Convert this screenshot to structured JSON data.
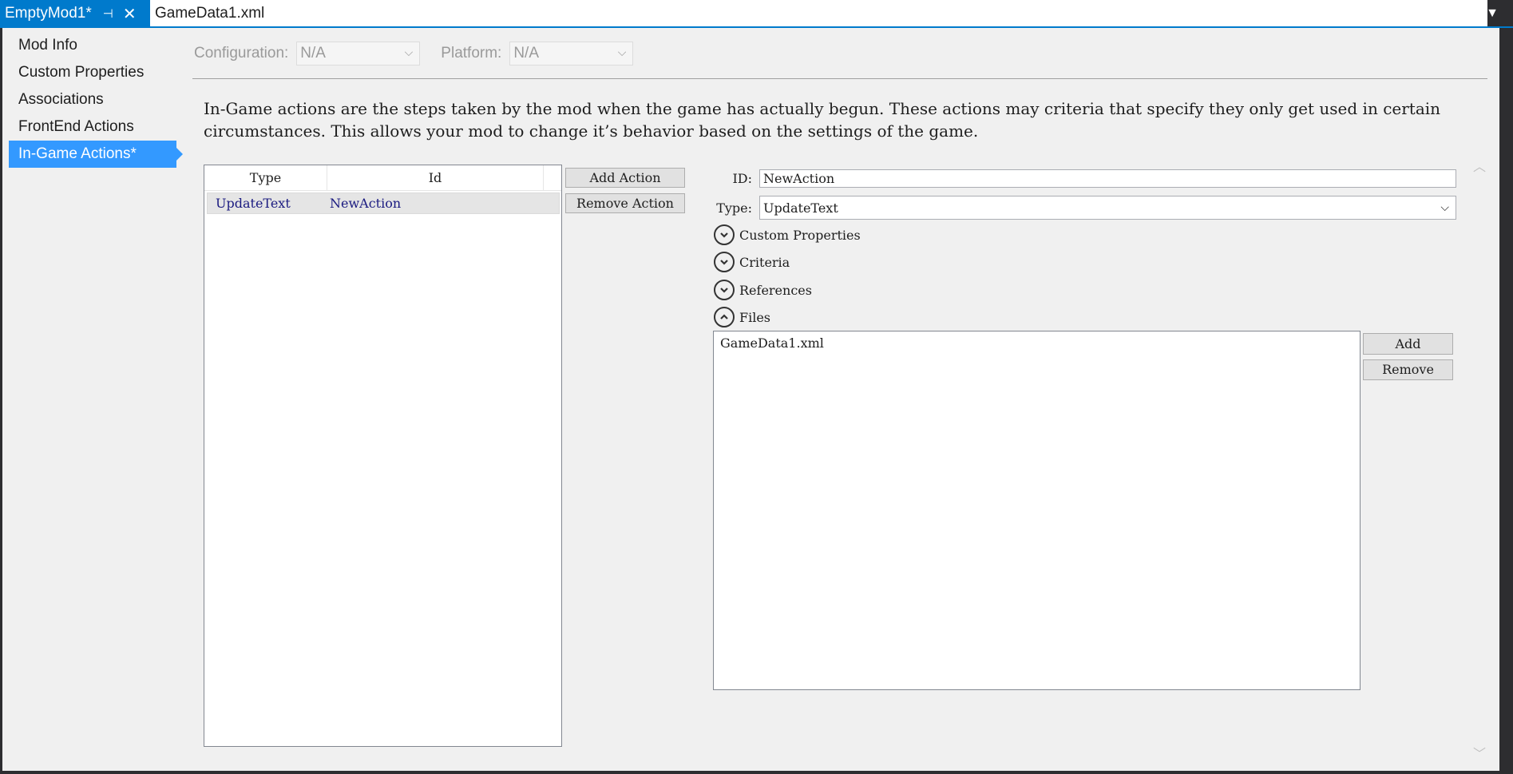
{
  "tabs": [
    {
      "label": "EmptyMod1*",
      "active": true
    },
    {
      "label": "GameData1.xml",
      "active": false
    }
  ],
  "icons": {
    "pin": "pin-icon",
    "close": "close-icon",
    "dropdown": "chevron-down-icon"
  },
  "nav": {
    "items": [
      {
        "label": "Mod Info"
      },
      {
        "label": "Custom Properties"
      },
      {
        "label": "Associations"
      },
      {
        "label": "FrontEnd Actions"
      },
      {
        "label": "In-Game Actions*"
      }
    ],
    "selected_index": 4
  },
  "config": {
    "configuration_label": "Configuration:",
    "configuration_value": "N/A",
    "platform_label": "Platform:",
    "platform_value": "N/A"
  },
  "description": "In-Game actions are the steps taken by the mod when the game has actually begun.  These actions may criteria that specify they only get used in certain circumstances.  This allows your mod to change it’s behavior based on the settings of the game.",
  "actions_list": {
    "columns": [
      "Type",
      "Id"
    ],
    "rows": [
      {
        "type": "UpdateText",
        "id": "NewAction"
      }
    ]
  },
  "buttons": {
    "add_action": "Add Action",
    "remove_action": "Remove Action",
    "add": "Add",
    "remove": "Remove"
  },
  "detail": {
    "id_label": "ID:",
    "id_value": "NewAction",
    "type_label": "Type:",
    "type_value": "UpdateText"
  },
  "expanders": [
    {
      "label": "Custom Properties",
      "expanded": false
    },
    {
      "label": "Criteria",
      "expanded": false
    },
    {
      "label": "References",
      "expanded": false
    },
    {
      "label": "Files",
      "expanded": true
    }
  ],
  "files": [
    "GameData1.xml"
  ],
  "colors": {
    "accent": "#007acc",
    "selected_nav": "#3399ff",
    "background": "#f0f0f0"
  }
}
